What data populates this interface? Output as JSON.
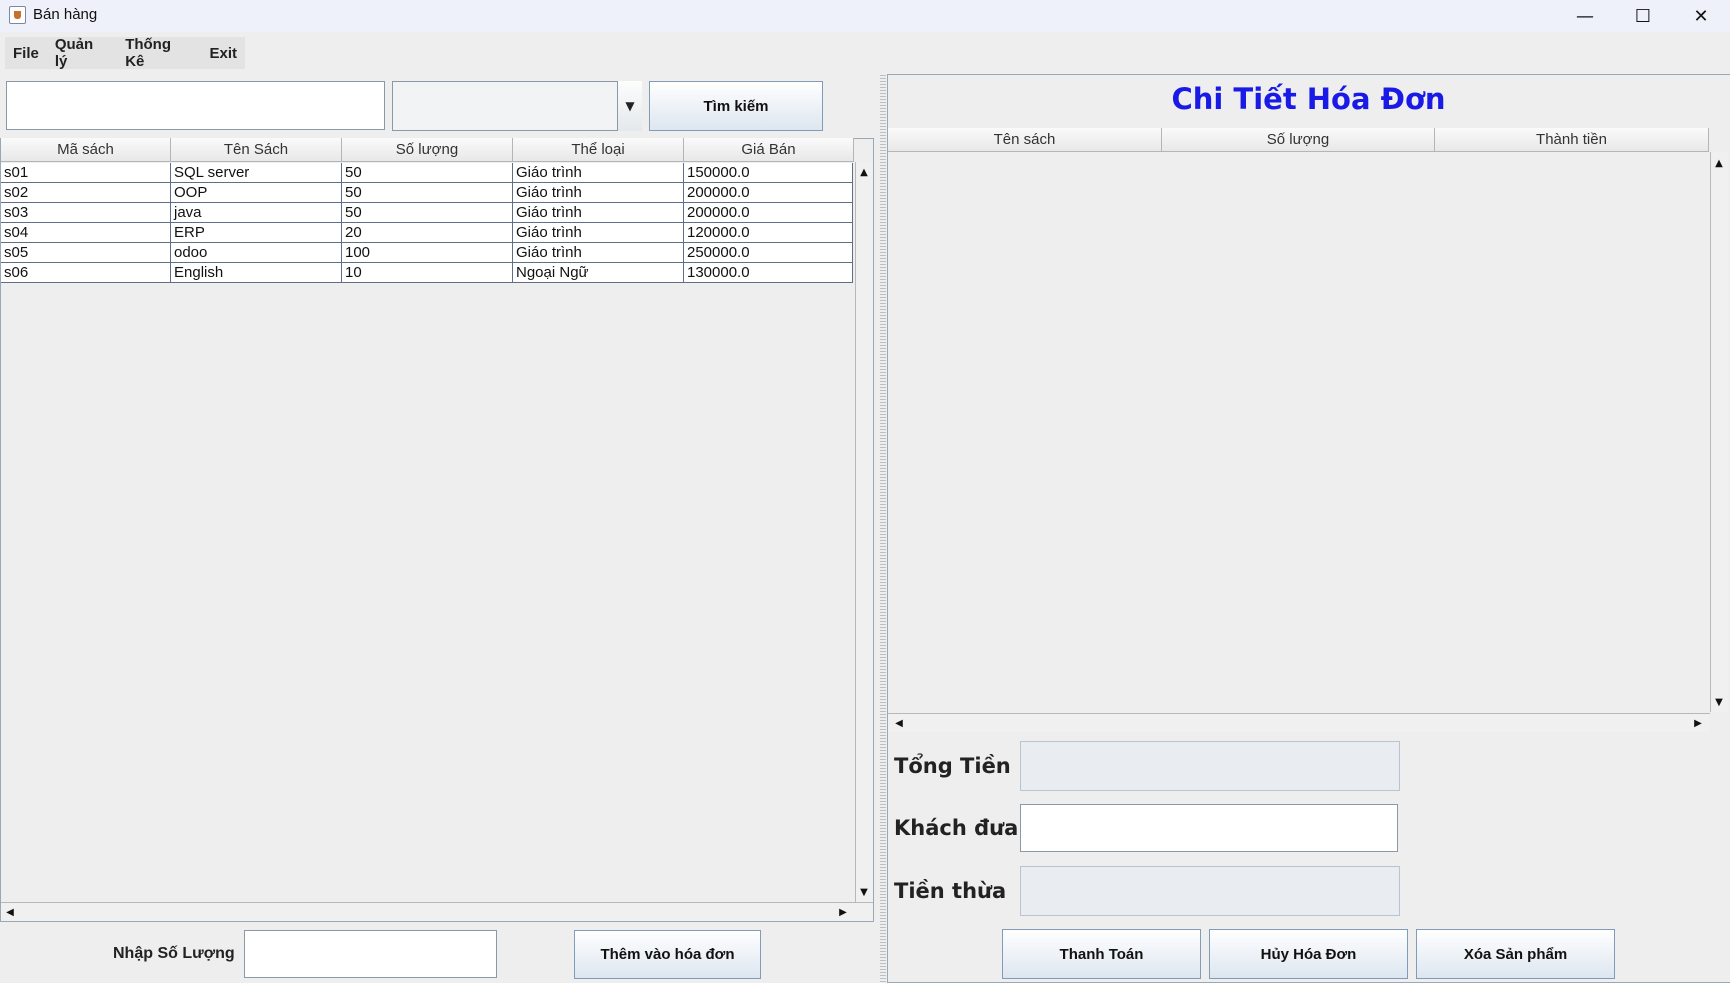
{
  "window": {
    "title": "Bán hàng",
    "controls": {
      "minimize": "—",
      "maximize": "☐",
      "close": "✕"
    }
  },
  "menu": [
    "File",
    "Quản lý",
    "Thống Kê",
    "Exit"
  ],
  "search": {
    "query": "",
    "category_selected": "",
    "button_label": "Tìm kiếm"
  },
  "books_table": {
    "columns": [
      "Mã sách",
      "Tên Sách",
      "Số lượng",
      "Thể loại",
      "Giá Bán"
    ],
    "rows": [
      [
        "s01",
        "SQL server",
        "50",
        "Giáo trình",
        "150000.0"
      ],
      [
        "s02",
        "OOP",
        "50",
        "Giáo trình",
        "200000.0"
      ],
      [
        "s03",
        "java",
        "50",
        "Giáo trình",
        "200000.0"
      ],
      [
        "s04",
        "ERP",
        "20",
        "Giáo trình",
        "120000.0"
      ],
      [
        "s05",
        "odoo",
        "100",
        "Giáo trình",
        "250000.0"
      ],
      [
        "s06",
        "English",
        "10",
        "Ngoại Ngữ",
        "130000.0"
      ]
    ]
  },
  "quantity": {
    "label": "Nhập Số Lượng",
    "value": ""
  },
  "add_button": "Thêm vào hóa đơn",
  "detail": {
    "title": "Chi Tiết Hóa Đơn",
    "columns": [
      "Tên sách",
      "Số lượng",
      "Thành tiền"
    ]
  },
  "totals": {
    "total_label": "Tổng Tiền",
    "total_value": "",
    "paid_label": "Khách đưa",
    "paid_value": "",
    "change_label": "Tiền thừa",
    "change_value": ""
  },
  "actions": {
    "pay": "Thanh Toán",
    "cancel": "Hủy Hóa Đơn",
    "delete": "Xóa Sản phẩm"
  },
  "scroll_arrows": {
    "up": "▲",
    "down": "▼",
    "left": "◀",
    "right": "▶",
    "combo": "▼"
  }
}
